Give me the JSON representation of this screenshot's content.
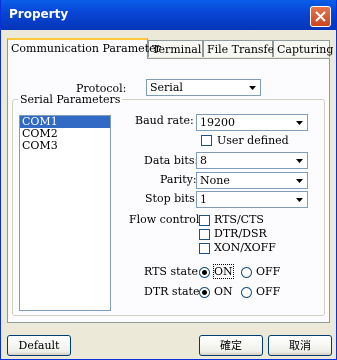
{
  "window": {
    "title": "Property"
  },
  "tabs": [
    {
      "label": "Communication Parameter"
    },
    {
      "label": "Terminal"
    },
    {
      "label": "File Transfer"
    },
    {
      "label": "Capturing"
    }
  ],
  "protocol": {
    "label": "Protocol:",
    "value": "Serial"
  },
  "serial": {
    "group_label": "Serial Parameters",
    "ports": [
      "COM1",
      "COM2",
      "COM3"
    ],
    "selected_port": "COM1",
    "baud_label": "Baud rate:",
    "baud_value": "19200",
    "user_defined_label": "User defined",
    "data_bits_label": "Data bits:",
    "data_bits_value": "8",
    "parity_label": "Parity:",
    "parity_value": "None",
    "stop_bits_label": "Stop bits:",
    "stop_bits_value": "1",
    "flow_label": "Flow control:",
    "flow_options": [
      "RTS/CTS",
      "DTR/DSR",
      "XON/XOFF"
    ],
    "rts_label": "RTS state:",
    "dtr_label": "DTR state:",
    "on_label": "ON",
    "off_label": "OFF",
    "rts_state": "ON",
    "dtr_state": "ON"
  },
  "buttons": {
    "default": "Default",
    "ok": "確定",
    "cancel": "取消"
  },
  "colors": {
    "titlebar": "#0846D6",
    "selection": "#316AC5",
    "close": "#C94520"
  }
}
